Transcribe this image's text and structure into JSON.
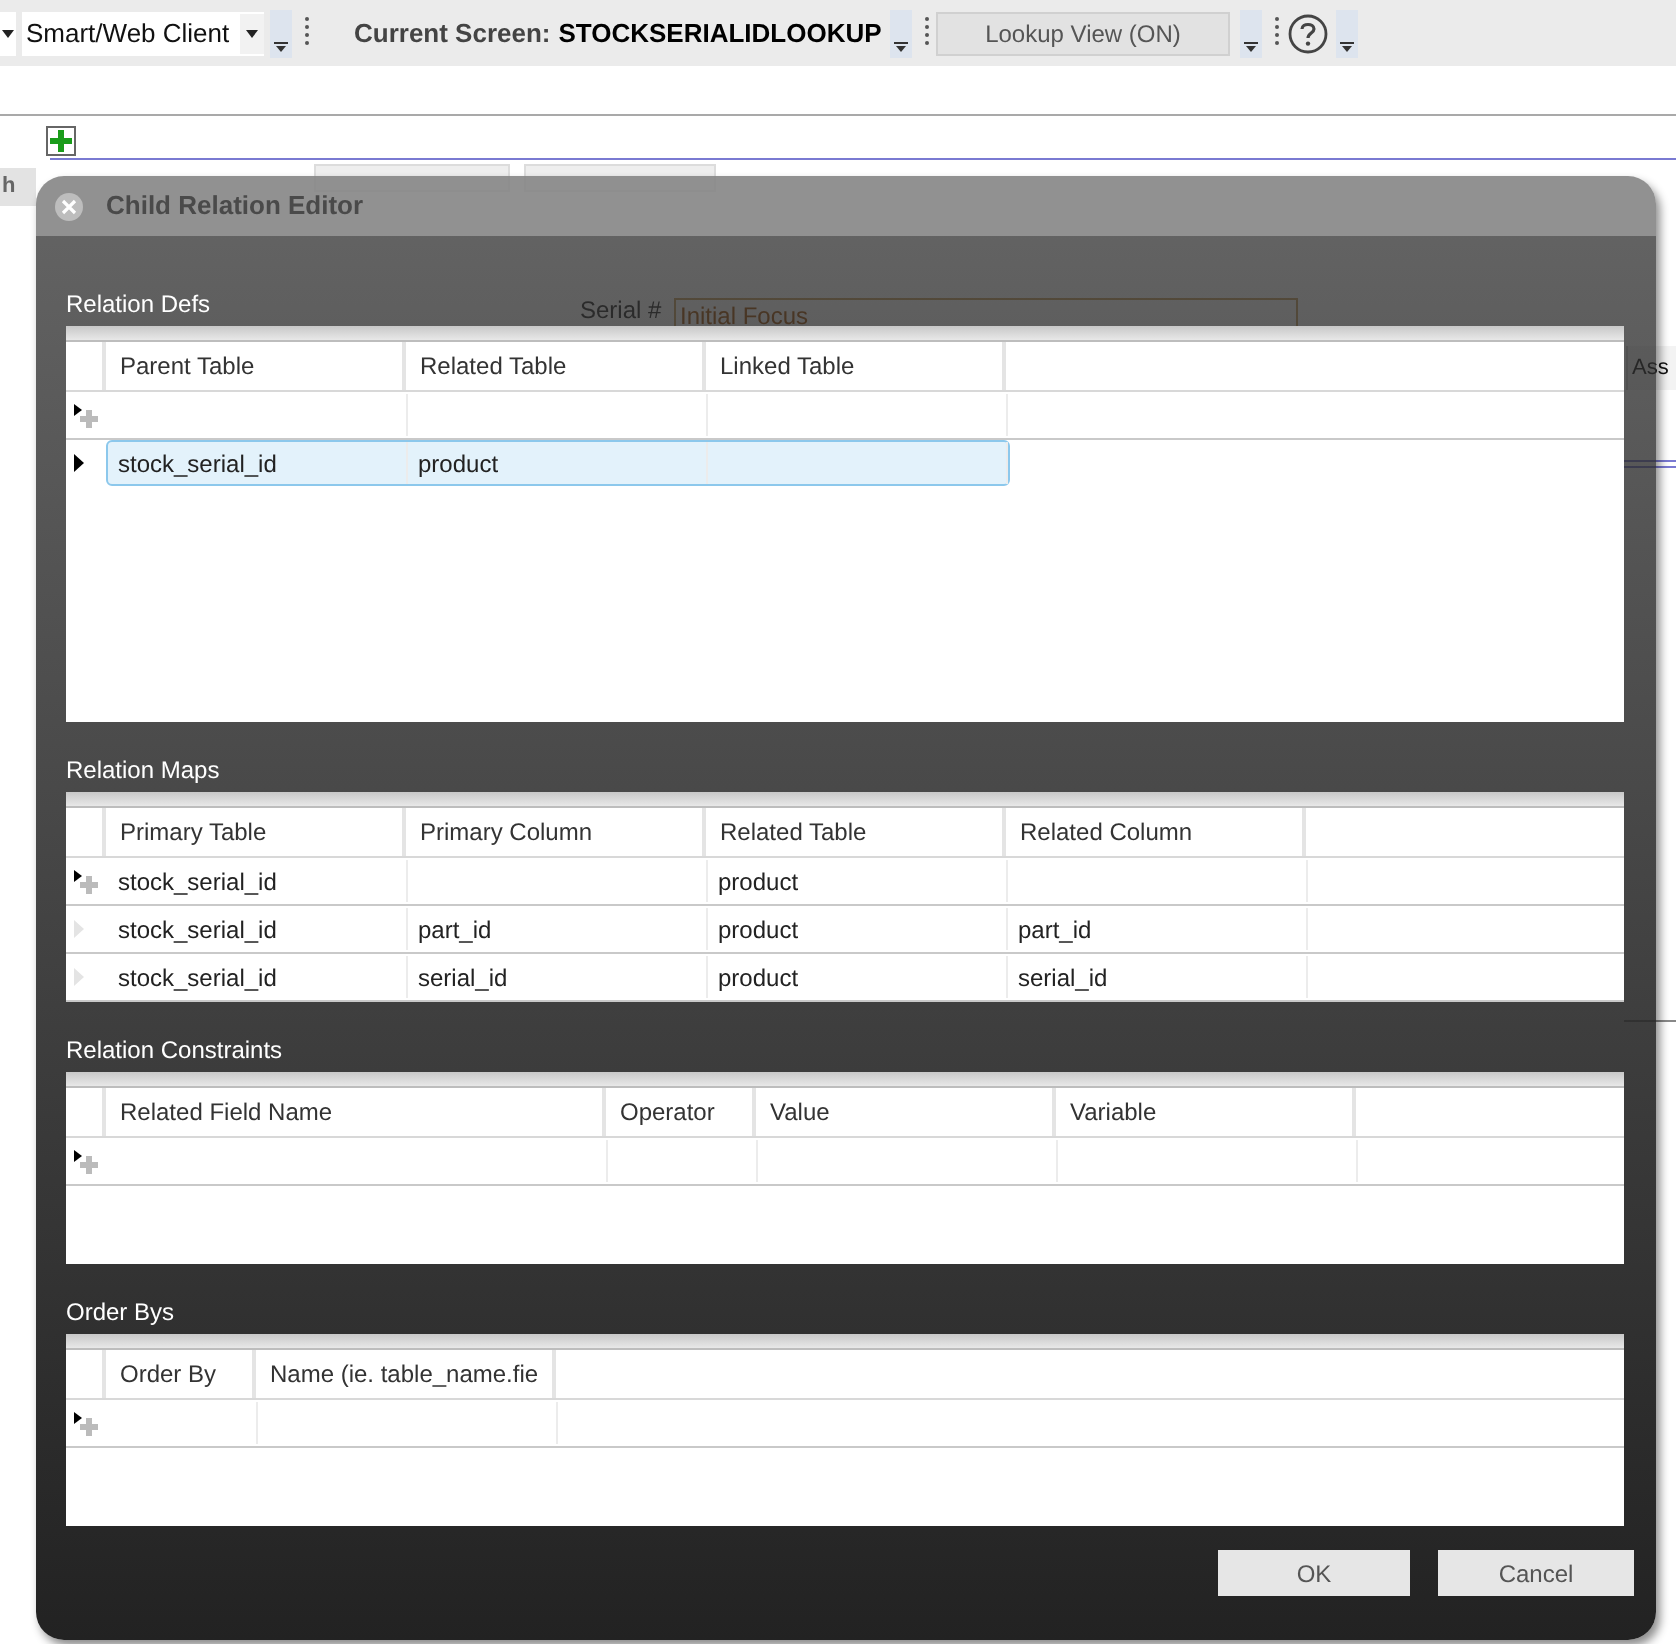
{
  "toolbar": {
    "client_select": "Smart/Web Client",
    "current_screen_label": "Current Screen:",
    "current_screen_value": "STOCKSERIALIDLOOKUP",
    "lookup_button": "Lookup View (ON)"
  },
  "background": {
    "tab_fragment": "h",
    "serial_label": "Serial #",
    "serial_placeholder": "Initial Focus",
    "column_fragment": "Ass"
  },
  "dialog": {
    "title": "Child Relation Editor",
    "sections": [
      {
        "title": "Relation Defs",
        "columns": [
          "Parent Table",
          "Related Table",
          "Linked Table"
        ],
        "rows": [
          {
            "kind": "new",
            "selected": false,
            "cells": [
              null,
              null,
              null
            ]
          },
          {
            "kind": "data",
            "selected": true,
            "cells": [
              "stock_serial_id",
              "product",
              null
            ]
          }
        ]
      },
      {
        "title": "Relation Maps",
        "columns": [
          "Primary Table",
          "Primary Column",
          "Related Table",
          "Related Column"
        ],
        "rows": [
          {
            "kind": "new",
            "selected": false,
            "cells": [
              "stock_serial_id",
              null,
              "product",
              null
            ]
          },
          {
            "kind": "data",
            "selected": false,
            "cells": [
              "stock_serial_id",
              "part_id",
              "product",
              "part_id"
            ]
          },
          {
            "kind": "data",
            "selected": false,
            "cells": [
              "stock_serial_id",
              "serial_id",
              "product",
              "serial_id"
            ]
          }
        ]
      },
      {
        "title": "Relation Constraints",
        "columns": [
          "Related Field Name",
          "Operator",
          "Value",
          "Variable"
        ],
        "rows": [
          {
            "kind": "new",
            "selected": false,
            "cells": [
              null,
              null,
              null,
              null
            ]
          }
        ]
      },
      {
        "title": "Order Bys",
        "columns": [
          "Order By",
          "Name (ie. table_name.fie"
        ],
        "rows": [
          {
            "kind": "new",
            "selected": false,
            "cells": [
              null,
              null
            ]
          }
        ]
      }
    ],
    "buttons": [
      "OK",
      "Cancel"
    ]
  }
}
